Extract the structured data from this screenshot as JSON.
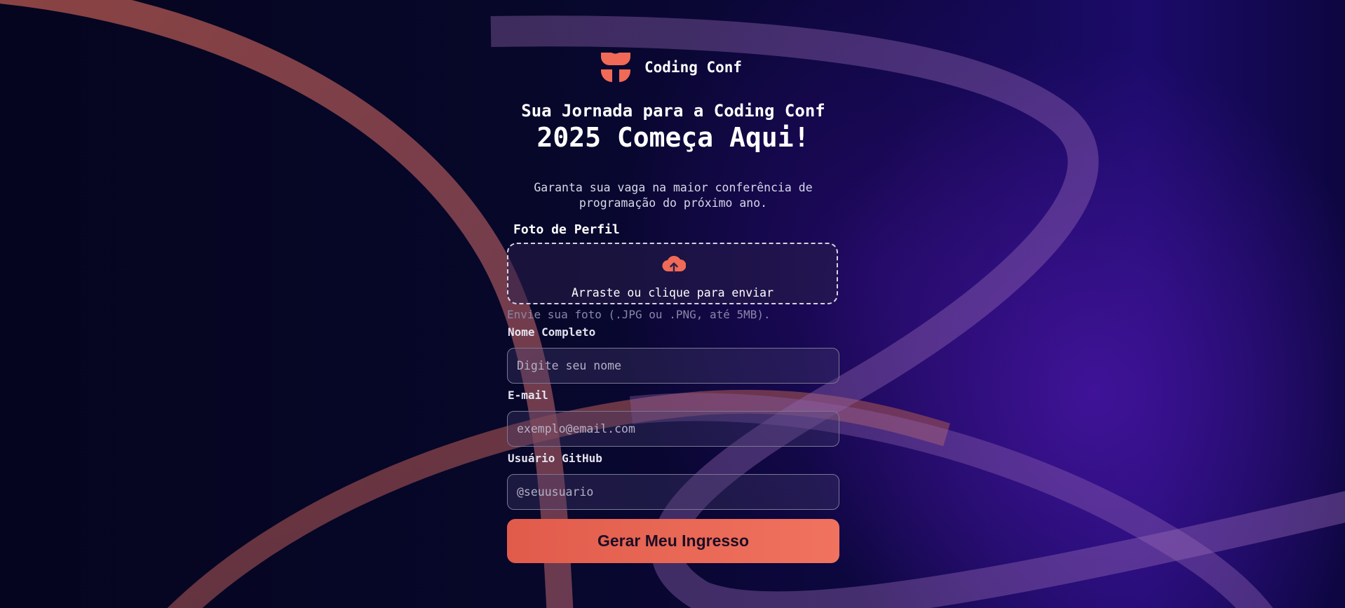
{
  "brand": {
    "name": "Coding Conf",
    "logo_icon": "coding-conf-logo-icon",
    "accent_color": "#f06a57"
  },
  "hero": {
    "headline_line1": "Sua Jornada para a Coding Conf",
    "headline_line2": "2025 Começa Aqui!",
    "subtitle_line1": "Garanta sua vaga na maior conferência de",
    "subtitle_line2": "programação do próximo ano."
  },
  "form": {
    "photo": {
      "label": "Foto de Perfil",
      "dropzone_text": "Arraste ou clique para enviar",
      "icon": "cloud-upload-icon",
      "hint": "Envie sua foto (.JPG ou .PNG, até 5MB)."
    },
    "name": {
      "label": "Nome Completo",
      "placeholder": "Digite seu nome",
      "value": ""
    },
    "email": {
      "label": "E-mail",
      "placeholder": "exemplo@email.com",
      "value": ""
    },
    "github": {
      "label": "Usuário GitHub",
      "placeholder": "@seuusuario",
      "value": ""
    },
    "submit_label": "Gerar Meu Ingresso"
  }
}
